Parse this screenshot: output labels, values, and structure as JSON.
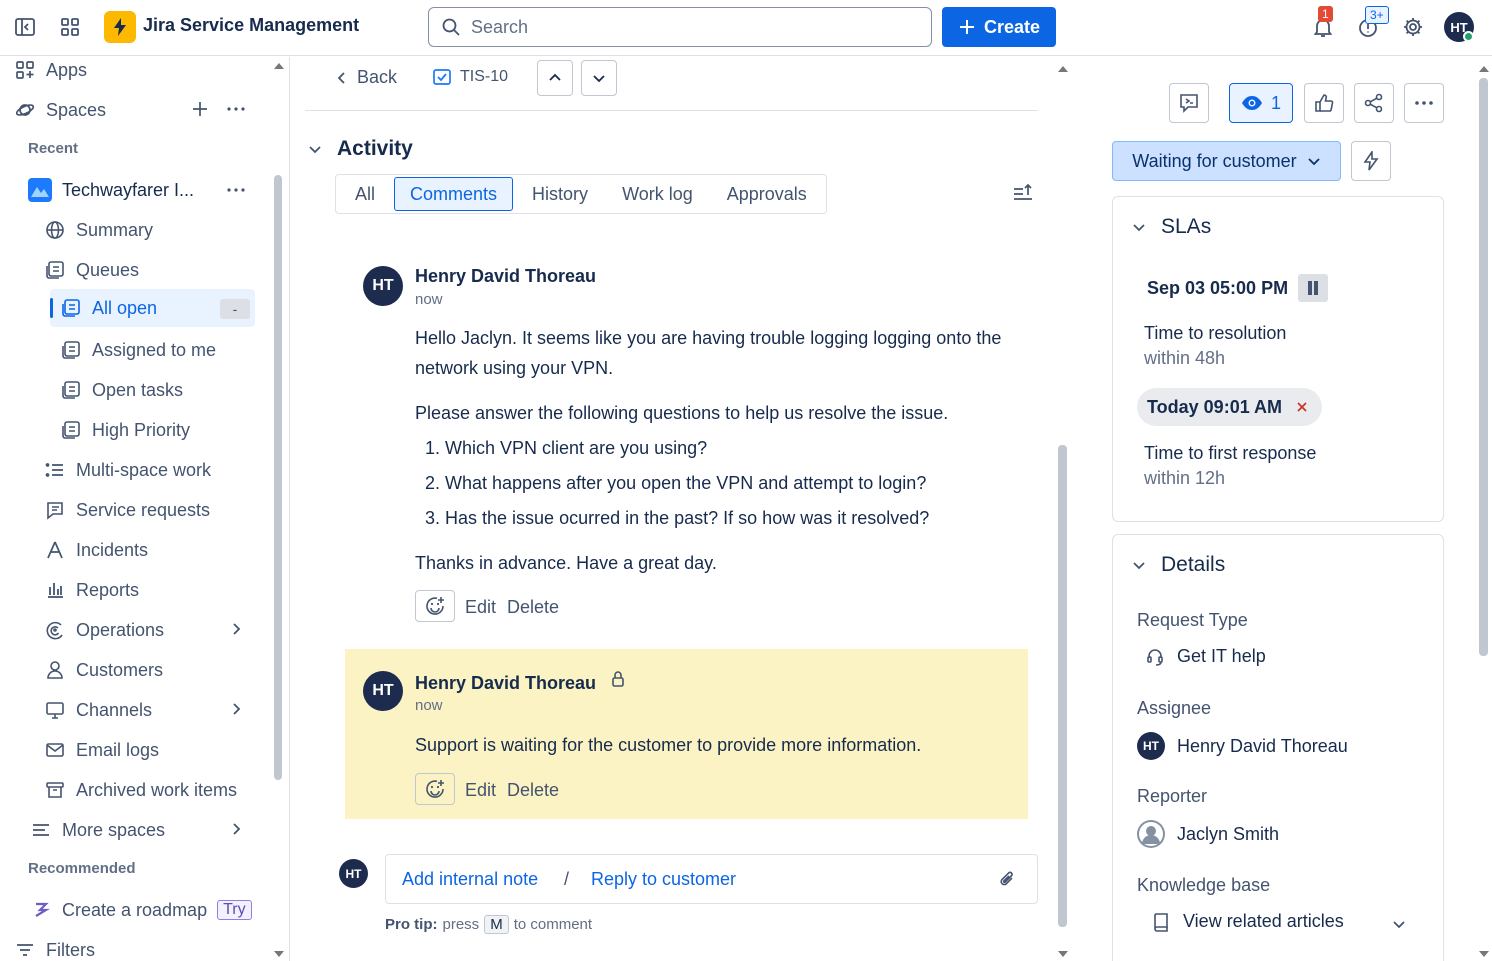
{
  "topbar": {
    "app_name": "Jira Service Management",
    "search_placeholder": "Search",
    "create_label": "Create",
    "notifications_count": "1",
    "help_count": "3+",
    "user_initials": "HT"
  },
  "sidebar": {
    "apps": "Apps",
    "spaces": "Spaces",
    "recent_heading": "Recent",
    "space_name": "Techwayfarer I...",
    "items": {
      "summary": "Summary",
      "queues": "Queues",
      "all_open": "All open",
      "all_open_count": "-",
      "assigned_to_me": "Assigned to me",
      "open_tasks": "Open tasks",
      "high_priority": "High Priority",
      "multi_space_work": "Multi-space work",
      "service_requests": "Service requests",
      "incidents": "Incidents",
      "reports": "Reports",
      "operations": "Operations",
      "customers": "Customers",
      "channels": "Channels",
      "email_logs": "Email logs",
      "archived_work_items": "Archived work items",
      "more_spaces": "More spaces"
    },
    "recommended_heading": "Recommended",
    "create_roadmap": "Create a roadmap",
    "try_badge": "Try",
    "filters": "Filters"
  },
  "main": {
    "back_label": "Back",
    "issue_key": "TIS-10",
    "activity_heading": "Activity",
    "tabs": [
      "All",
      "Comments",
      "History",
      "Work log",
      "Approvals"
    ],
    "active_tab": "Comments",
    "comment1": {
      "author": "Henry David Thoreau",
      "initials": "HT",
      "time": "now",
      "para1": "Hello Jaclyn. It seems like you are having trouble logging logging onto the network using your VPN.",
      "para2": "Please answer the following questions to help us resolve the issue.",
      "list": [
        "Which VPN client are you using?",
        "What happens after you open the VPN and attempt to login?",
        "Has the issue ocurred in the past? If so how was it resolved?"
      ],
      "para3": "Thanks in advance. Have a great day.",
      "edit": "Edit",
      "delete": "Delete"
    },
    "comment2": {
      "author": "Henry David Thoreau",
      "initials": "HT",
      "time": "now",
      "text": "Support is waiting for the customer to provide more information.",
      "edit": "Edit",
      "delete": "Delete"
    },
    "composer": {
      "initials": "HT",
      "add_internal_note": "Add internal note",
      "separator": "/",
      "reply_to_customer": "Reply to customer",
      "pro_tip_label": "Pro tip:",
      "pro_tip_press": "press",
      "pro_tip_key": "M",
      "pro_tip_suffix": "to comment"
    }
  },
  "right": {
    "watch_count": "1",
    "status": "Waiting for customer",
    "slas": {
      "heading": "SLAs",
      "sla1_time": "Sep 03 05:00 PM",
      "sla1_name": "Time to resolution",
      "sla1_target": "within 48h",
      "sla2_time": "Today 09:01 AM",
      "sla2_name": "Time to first response",
      "sla2_target": "within 12h"
    },
    "details": {
      "heading": "Details",
      "request_type_label": "Request Type",
      "request_type_value": "Get IT help",
      "assignee_label": "Assignee",
      "assignee_initials": "HT",
      "assignee_value": "Henry David Thoreau",
      "reporter_label": "Reporter",
      "reporter_value": "Jaclyn Smith",
      "kb_label": "Knowledge base",
      "kb_value": "View related articles"
    }
  },
  "colors": {
    "brand_blue": "#0c66e4",
    "status_bg": "#cce0ff",
    "internal_note_bg": "#fbf3c4",
    "logo_yellow": "#fcb900",
    "avatar_navy": "#1d2b4f"
  }
}
